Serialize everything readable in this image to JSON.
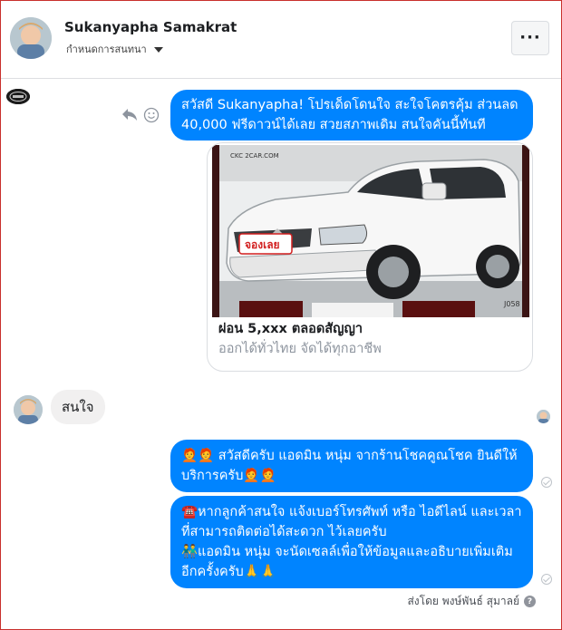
{
  "header": {
    "name": "Sukanyapha Samakrat",
    "subtitle": "กำหนดการสนทนา",
    "more_label": "···"
  },
  "messages": {
    "greeting": "สวัสดี Sukanyapha! โปรเด็ดโดนใจ สะใจโคตรคุ้ม ส่วนลด 40,000 ฟรีดาวน์ได้เลย สวยสภาพเดิม สนใจคันนี้ทันที",
    "card": {
      "image_watermark": "CKC 2CAR.COM",
      "image_sticker": "จองเลย",
      "image_code": "J058",
      "title": "ผ่อน 5,xxx ตลอดสัญญา",
      "description": "ออกได้ทั่วไทย จัดได้ทุกอาชีพ"
    },
    "user_reply": "สนใจ",
    "admin_1": "🧑‍🦰🧑‍🦰 สวัสดีครับ แอดมิน หนุ่ม จากร้านโชคคูณโชค ยินดีให้บริการครับ🧑‍🦰🧑‍🦰",
    "admin_2_line1": "☎️หากลูกค้าสนใจ แจ้งเบอร์โทรศัพท์ หรือ ไอดีไลน์ และเวลาที่สามารถติดต่อได้สะดวก ไว้เลยครับ",
    "admin_2_line2": "👬แอดมิน หนุ่ม จะนัดเซลล์เพื่อให้ข้อมูลและอธิบายเพิ่มเติมอีกครั้งครับ🙏🙏"
  },
  "footer": {
    "sent_by": "ส่งโดย พงษ์พันธ์ สุมาลย์",
    "help_label": "?"
  },
  "colors": {
    "bubble_out": "#0084ff",
    "bubble_in": "#f1f0f0",
    "muted": "#8d949e"
  },
  "icons": [
    "reply-icon",
    "smiley-icon",
    "more-icon",
    "caret-down-icon",
    "check-circle-icon",
    "help-icon"
  ]
}
